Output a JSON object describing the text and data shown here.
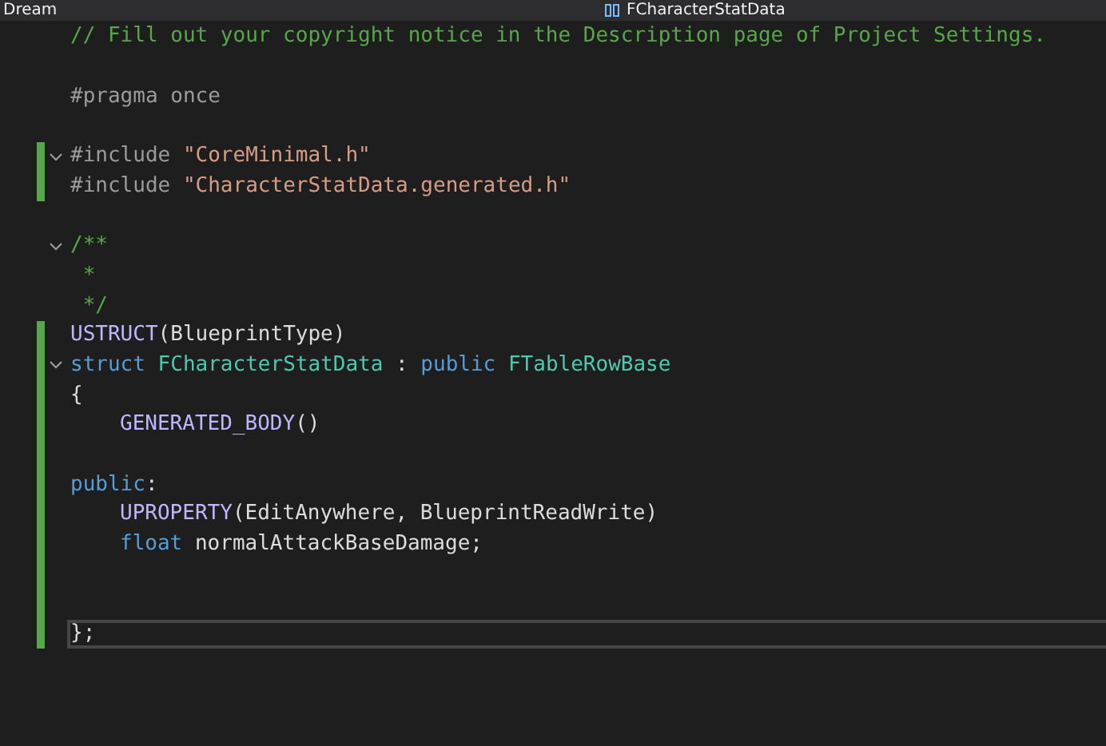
{
  "tabs": {
    "project": "Dream",
    "member": "FCharacterStatData"
  },
  "lines": [
    {
      "changed": false,
      "fold": false,
      "current": false,
      "indented": false,
      "tokens": [
        {
          "kind": "comment",
          "text": "// Fill out your copyright notice in the Description page of Project Settings."
        }
      ]
    },
    {
      "changed": false,
      "fold": false,
      "current": false
    },
    {
      "changed": false,
      "fold": false,
      "current": false,
      "indented": false,
      "tokens": [
        {
          "kind": "preproc",
          "text": "#pragma once"
        }
      ]
    },
    {
      "changed": false,
      "fold": false,
      "current": false
    },
    {
      "changed": true,
      "fold": true,
      "current": false,
      "indented": false,
      "tokens": [
        {
          "kind": "preproc",
          "text": "#include "
        },
        {
          "kind": "string",
          "text": "\"CoreMinimal.h\""
        }
      ]
    },
    {
      "changed": true,
      "fold": false,
      "current": false,
      "indented": false,
      "tokens": [
        {
          "kind": "preproc",
          "text": "#include "
        },
        {
          "kind": "string",
          "text": "\"CharacterStatData.generated.h\""
        }
      ]
    },
    {
      "changed": false,
      "fold": false,
      "current": false
    },
    {
      "changed": false,
      "fold": true,
      "current": false,
      "indented": false,
      "tokens": [
        {
          "kind": "comment",
          "text": "/**"
        }
      ]
    },
    {
      "changed": false,
      "fold": false,
      "current": false,
      "indented": false,
      "tokens": [
        {
          "kind": "comment",
          "text": " *"
        }
      ]
    },
    {
      "changed": false,
      "fold": false,
      "current": false,
      "indented": false,
      "tokens": [
        {
          "kind": "comment",
          "text": " */"
        }
      ]
    },
    {
      "changed": true,
      "fold": false,
      "current": false,
      "indented": false,
      "tokens": [
        {
          "kind": "macro",
          "text": "USTRUCT"
        },
        {
          "kind": "text",
          "text": "(BlueprintType)"
        }
      ]
    },
    {
      "changed": true,
      "fold": true,
      "current": false,
      "indented": false,
      "tokens": [
        {
          "kind": "keyword",
          "text": "struct "
        },
        {
          "kind": "type",
          "text": "FCharacterStatData"
        },
        {
          "kind": "text",
          "text": " : "
        },
        {
          "kind": "keyword",
          "text": "public "
        },
        {
          "kind": "type",
          "text": "FTableRowBase"
        }
      ]
    },
    {
      "changed": true,
      "fold": false,
      "current": false,
      "indented": false,
      "tokens": [
        {
          "kind": "text",
          "text": "{"
        }
      ]
    },
    {
      "changed": true,
      "fold": false,
      "current": false,
      "indented": true,
      "tokens": [
        {
          "kind": "macro",
          "text": "GENERATED_BODY"
        },
        {
          "kind": "text",
          "text": "()"
        }
      ]
    },
    {
      "changed": true,
      "fold": false,
      "current": false
    },
    {
      "changed": true,
      "fold": false,
      "current": false,
      "indented": false,
      "tokens": [
        {
          "kind": "keyword",
          "text": "public"
        },
        {
          "kind": "text",
          "text": ":"
        }
      ]
    },
    {
      "changed": true,
      "fold": false,
      "current": false,
      "indented": true,
      "tokens": [
        {
          "kind": "macro",
          "text": "UPROPERTY"
        },
        {
          "kind": "text",
          "text": "(EditAnywhere, BlueprintReadWrite)"
        }
      ]
    },
    {
      "changed": true,
      "fold": false,
      "current": false,
      "indented": true,
      "tokens": [
        {
          "kind": "keyword",
          "text": "float"
        },
        {
          "kind": "text",
          "text": " normalAttackBaseDamage;"
        }
      ]
    },
    {
      "changed": true,
      "fold": false,
      "current": false
    },
    {
      "changed": true,
      "fold": false,
      "current": false
    },
    {
      "changed": true,
      "fold": false,
      "current": true,
      "indented": false,
      "tokens": [
        {
          "kind": "text",
          "text": "};"
        }
      ]
    }
  ]
}
